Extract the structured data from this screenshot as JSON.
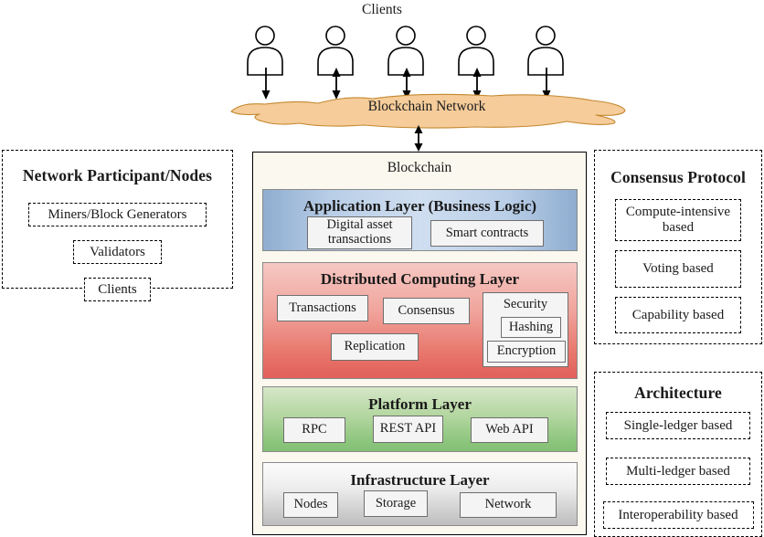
{
  "top": {
    "clients_label": "Clients",
    "client_count": 5,
    "network_label": "Blockchain Network",
    "network_color": "#f5cc9a",
    "network_border": "#c98a3c"
  },
  "left_panel": {
    "title": "Network Participant/Nodes",
    "items": [
      {
        "label": "Miners/Block Generators"
      },
      {
        "label": "Validators"
      },
      {
        "label": "Clients"
      }
    ]
  },
  "center": {
    "title": "Blockchain",
    "layers": [
      {
        "id": "application",
        "title": "Application Layer (Business Logic)",
        "color": "#a9c4e3",
        "boxes": [
          {
            "label": "Digital asset transactions"
          },
          {
            "label": "Smart contracts"
          }
        ]
      },
      {
        "id": "distributed",
        "title": "Distributed Computing Layer",
        "color": "#ec8f86",
        "boxes": [
          {
            "label": "Transactions"
          },
          {
            "label": "Consensus"
          },
          {
            "label": "Security"
          },
          {
            "label": "Replication"
          },
          {
            "label": "Hashing"
          },
          {
            "label": "Encryption"
          }
        ]
      },
      {
        "id": "platform",
        "title": "Platform Layer",
        "color": "#a8d295",
        "boxes": [
          {
            "label": "RPC"
          },
          {
            "label": "REST API"
          },
          {
            "label": "Web API"
          }
        ]
      },
      {
        "id": "infrastructure",
        "title": "Infrastructure Layer",
        "color": "#dcdcdc",
        "boxes": [
          {
            "label": "Nodes"
          },
          {
            "label": "Storage"
          },
          {
            "label": "Network"
          }
        ]
      }
    ]
  },
  "right_panels": [
    {
      "id": "consensus",
      "title": "Consensus Protocol",
      "items": [
        {
          "label": "Compute-intensive based"
        },
        {
          "label": "Voting based"
        },
        {
          "label": "Capability based"
        }
      ]
    },
    {
      "id": "architecture",
      "title": "Architecture",
      "items": [
        {
          "label": "Single-ledger based"
        },
        {
          "label": "Multi-ledger based"
        },
        {
          "label": "Interoperability based"
        }
      ]
    }
  ]
}
